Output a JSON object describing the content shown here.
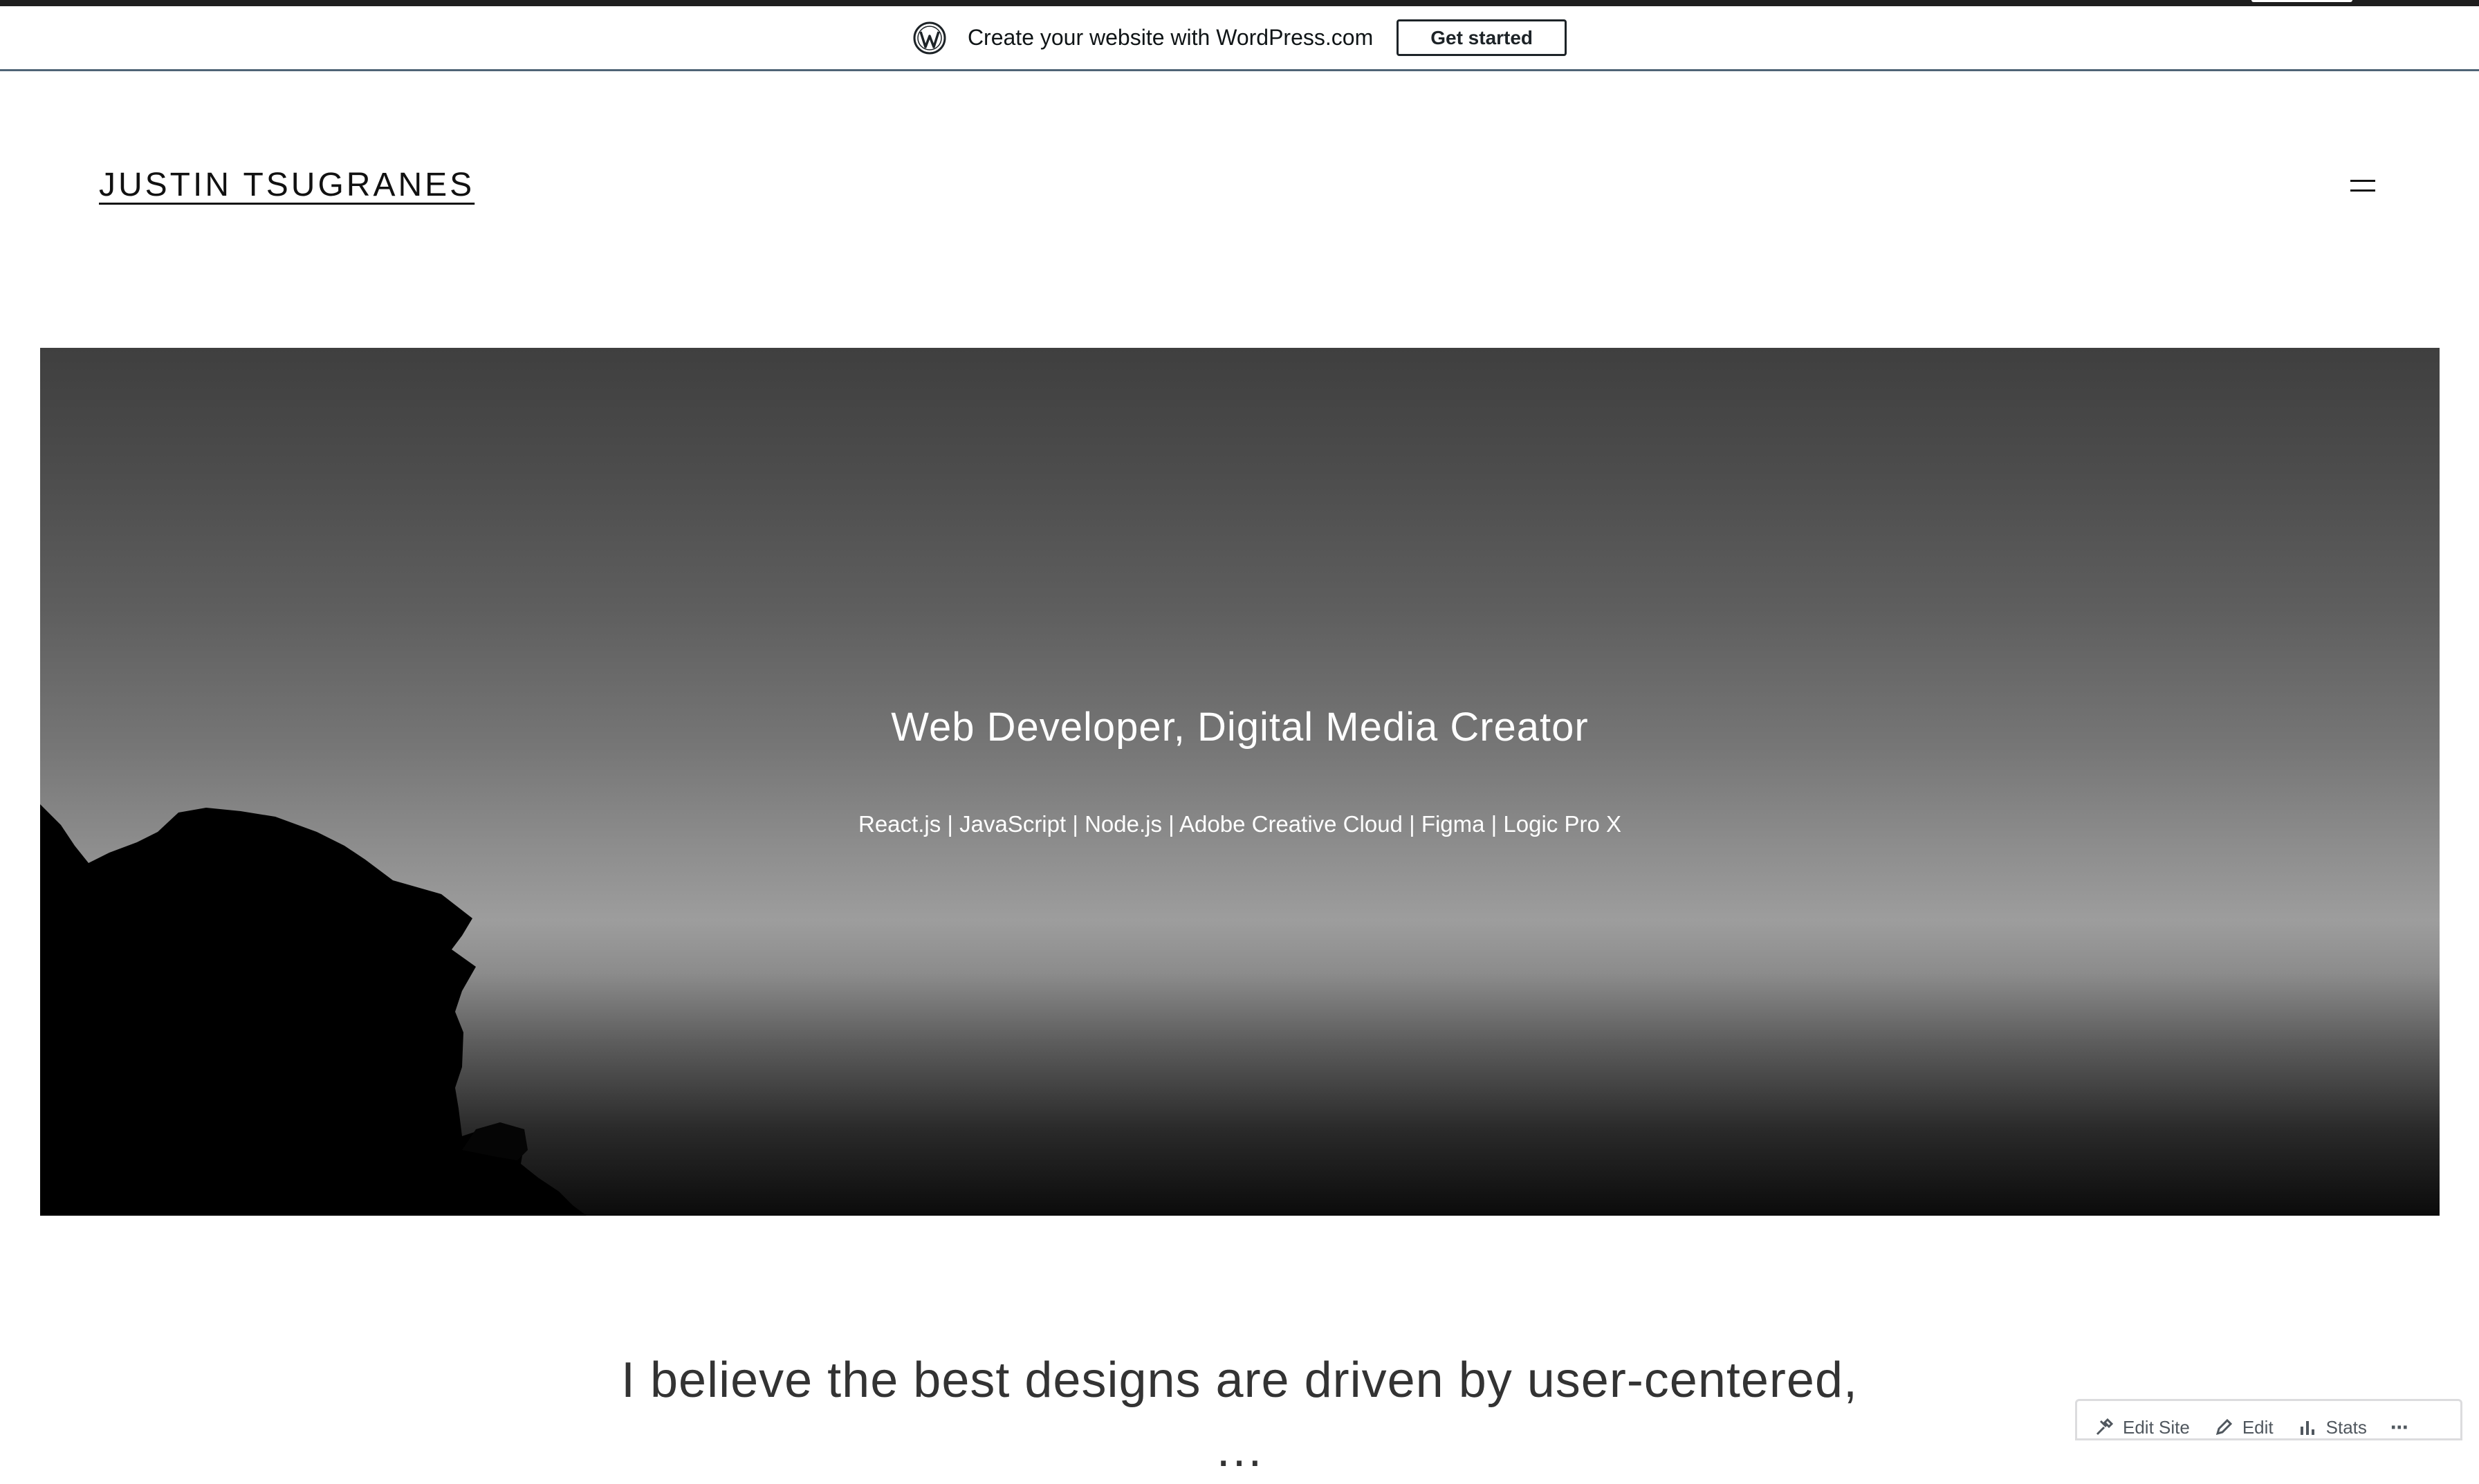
{
  "promo": {
    "text": "Create your website with WordPress.com",
    "cta_label": "Get started"
  },
  "header": {
    "site_title": "JUSTIN TSUGRANES"
  },
  "hero": {
    "title": "Web Developer, Digital Media Creator",
    "subtitle": "React.js | JavaScript | Node.js | Adobe Creative Cloud | Figma | Logic Pro X"
  },
  "statement": {
    "line1": "I believe the best designs are driven by user-centered,",
    "line2": "…"
  },
  "admin_bar": {
    "edit_site_label": "Edit Site",
    "edit_label": "Edit",
    "stats_label": "Stats",
    "more_label": "⋯"
  },
  "colors": {
    "promo_border": "#4f6476",
    "top_strip": "#1e1e1e",
    "text_dark": "#111111"
  }
}
